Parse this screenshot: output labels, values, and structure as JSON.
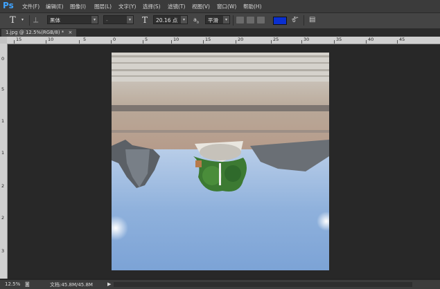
{
  "app": {
    "logo": "Ps"
  },
  "menu": [
    "文件(F)",
    "编辑(E)",
    "图像(I)",
    "图层(L)",
    "文字(Y)",
    "选择(S)",
    "滤镜(T)",
    "视图(V)",
    "窗口(W)",
    "帮助(H)"
  ],
  "options": {
    "font_family": "黑体",
    "font_style": "-",
    "font_size": "20.16 点",
    "aa_icon": "a",
    "aa_label": "a",
    "antialias": "平滑",
    "text_color": "#0a2fd0"
  },
  "document": {
    "tab_title": "1.jpg @ 12.5%(RGB/8) *",
    "close": "×"
  },
  "ruler_top_labels": [
    "15",
    "10",
    "5",
    "0",
    "5",
    "10",
    "15",
    "20",
    "25",
    "30",
    "35",
    "40",
    "45"
  ],
  "ruler_left_labels": [
    "0",
    "5",
    "1",
    "1",
    "2",
    "2",
    "3"
  ],
  "status": {
    "zoom": "12.5%",
    "doc_info": "文档:45.8M/45.8M",
    "arrow": "▶"
  }
}
